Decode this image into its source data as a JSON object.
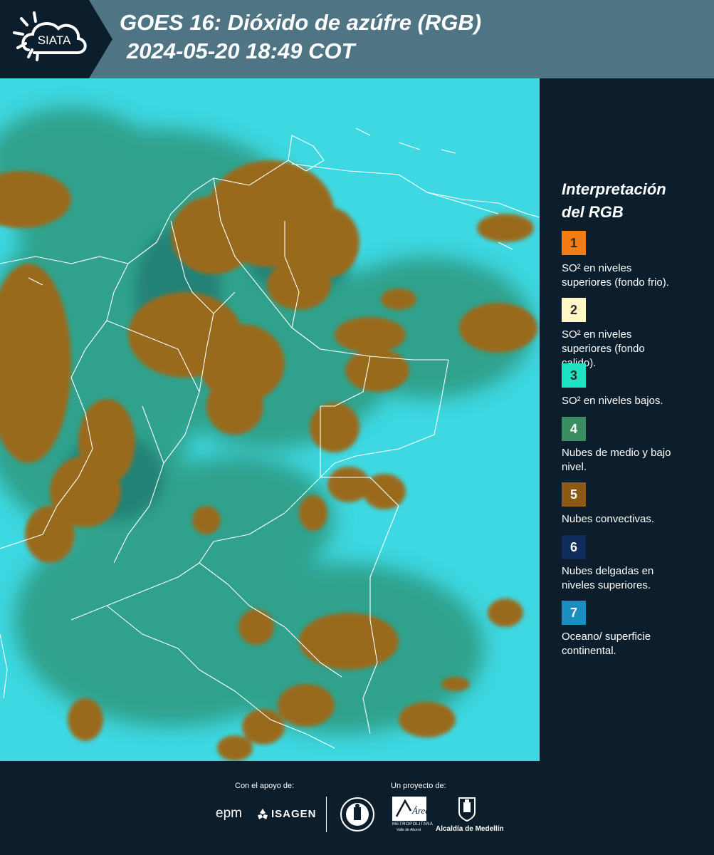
{
  "header": {
    "logo_text": "SIATA",
    "title_line1": "GOES 16: Dióxido de azúfre (RGB)",
    "title_line2": "2024-05-20 18:49 COT"
  },
  "map": {
    "description_icon": "satellite-rgb-map"
  },
  "legend": {
    "title_line1": "Interpretación",
    "title_line2": "del RGB",
    "items": [
      {
        "number": "1",
        "color": "#f47c12",
        "text_line1": "SO² en niveles",
        "text_line2": "superiores (fondo frio)."
      },
      {
        "number": "2",
        "color": "#fff8c4",
        "text_line1": "SO² en niveles",
        "text_line2": "superiores (fondo",
        "text_line3": "calido)."
      },
      {
        "number": "3",
        "color": "#1fe3c2",
        "text_line1": "SO² en niveles bajos."
      },
      {
        "number": "4",
        "color": "#3b8e62",
        "text_line1": "Nubes de medio y bajo",
        "text_line2": "nivel."
      },
      {
        "number": "5",
        "color": "#8d5a16",
        "text_line1": "Nubes convectivas."
      },
      {
        "number": "6",
        "color": "#0e2c5c",
        "text_line1": "Nubes delgadas en",
        "text_line2": "niveles superiores."
      },
      {
        "number": "7",
        "color": "#1a8fbf",
        "text_line1": "Oceano/ superficie",
        "text_line2": "continental."
      }
    ]
  },
  "footer": {
    "support_caption": "Con el apoyo de:",
    "project_caption": "Un proyecto de:",
    "epm_logo": "epm",
    "isagen_logo": "ISAGEN",
    "area_logo_script": "Área",
    "area_logo_line1": "METROPOLITANA",
    "area_logo_line2": "Valle de Aburrá",
    "alcaldia_logo": "Alcaldía de Medellín"
  },
  "colors": {
    "background": "#0c1e2b",
    "header_panel": "#4f7584",
    "ocean_cyan": "#38d4e0",
    "convective_brown": "#9a6a1e",
    "vegetation_green": "#2f8f6a"
  }
}
